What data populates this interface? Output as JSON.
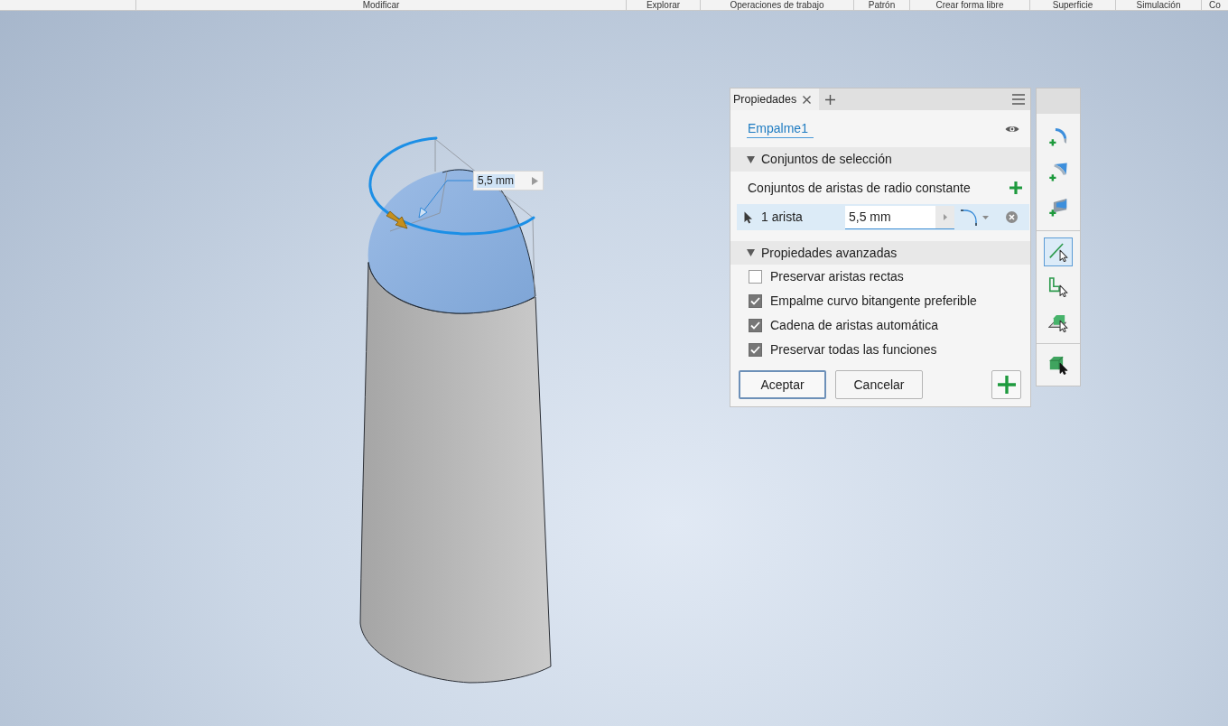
{
  "ribbon_panels": [
    {
      "label": "Modificar"
    },
    {
      "label": "Explorar"
    },
    {
      "label": "Operaciones de trabajo"
    },
    {
      "label": "Patrón"
    },
    {
      "label": "Crear forma libre"
    },
    {
      "label": "Superficie"
    },
    {
      "label": "Simulación"
    },
    {
      "label": "Co"
    }
  ],
  "viewport": {
    "dimension": {
      "value": "5,5 mm"
    }
  },
  "properties_panel": {
    "tab": {
      "label": "Propiedades"
    },
    "feature_name": "Empalme1",
    "selection_section": {
      "title": "Conjuntos de selección",
      "expanded": true,
      "group_label": "Conjuntos de aristas de radio constante",
      "sets": [
        {
          "label": "1 arista",
          "radius": "5,5 mm",
          "selected": true
        }
      ]
    },
    "advanced_section": {
      "title": "Propiedades avanzadas",
      "expanded": true,
      "options": [
        {
          "label": "Preservar aristas rectas",
          "checked": false
        },
        {
          "label": "Empalme curvo bitangente preferible",
          "checked": true
        },
        {
          "label": "Cadena de aristas automática",
          "checked": true
        },
        {
          "label": "Preservar todas las funciones",
          "checked": true
        }
      ]
    },
    "buttons": [
      {
        "label": "Aceptar",
        "kind": "default"
      },
      {
        "label": "Cancelar",
        "kind": "normal"
      }
    ]
  },
  "toolbar": {
    "groups": [
      {
        "tools": [
          {
            "kind": "edge-fillet",
            "selected": false
          },
          {
            "kind": "face-fillet",
            "selected": false
          },
          {
            "kind": "full-round-fillet",
            "selected": false
          }
        ]
      },
      {
        "tools": [
          {
            "kind": "select-edge",
            "selected": true
          },
          {
            "kind": "select-loop",
            "selected": false
          },
          {
            "kind": "select-feature",
            "selected": false
          }
        ]
      },
      {
        "tools": [
          {
            "kind": "select-solid",
            "selected": false
          }
        ]
      }
    ]
  }
}
